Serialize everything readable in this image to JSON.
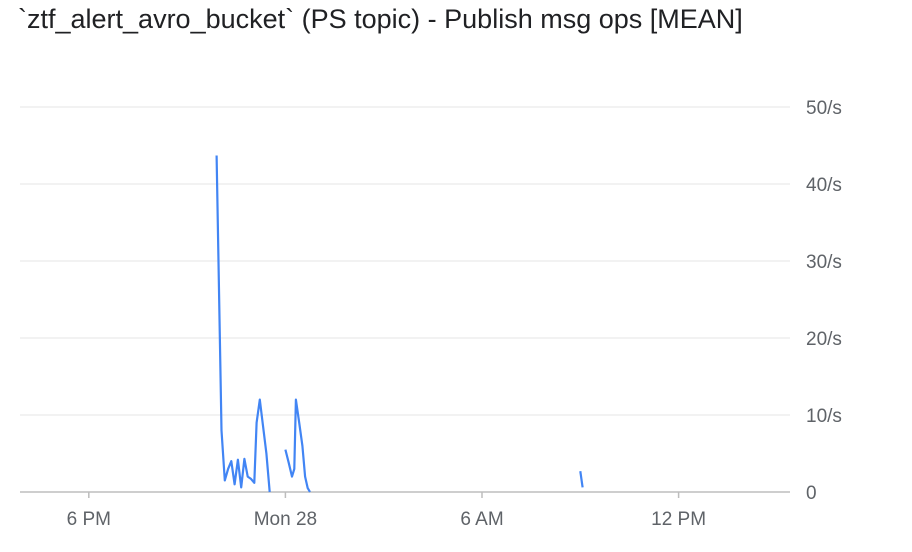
{
  "chart_data": {
    "type": "line",
    "title": "`ztf_alert_avro_bucket` (PS topic) - Publish msg ops [MEAN]",
    "xlabel": "",
    "ylabel": "",
    "y_ticks": [
      "0",
      "10/s",
      "20/s",
      "30/s",
      "40/s",
      "50/s"
    ],
    "ylim": [
      0,
      50
    ],
    "grid": true,
    "x_ticks": [
      {
        "label": "6 PM",
        "hour": 18
      },
      {
        "label": "Mon 28",
        "hour": 24
      },
      {
        "label": "6 AM",
        "hour": 30
      },
      {
        "label": "12 PM",
        "hour": 36
      }
    ],
    "xlim": [
      15.9,
      39.4
    ],
    "series": [
      {
        "color": "#4285f4",
        "segments": [
          [
            [
              21.9,
              43.7
            ],
            [
              22.05,
              8.0
            ],
            [
              22.15,
              1.5
            ],
            [
              22.25,
              3.0
            ],
            [
              22.35,
              4.0
            ],
            [
              22.45,
              1.0
            ],
            [
              22.55,
              4.2
            ],
            [
              22.65,
              0.6
            ],
            [
              22.75,
              4.3
            ],
            [
              22.85,
              2.0
            ],
            [
              22.95,
              1.7
            ],
            [
              23.05,
              1.2
            ],
            [
              23.12,
              9.0
            ],
            [
              23.22,
              12.0
            ],
            [
              23.32,
              8.5
            ],
            [
              23.42,
              5.0
            ],
            [
              23.52,
              0.0
            ]
          ],
          [
            [
              24.0,
              5.5
            ],
            [
              24.1,
              3.8
            ],
            [
              24.2,
              2.0
            ],
            [
              24.27,
              3.0
            ],
            [
              24.32,
              12.0
            ],
            [
              24.42,
              9.0
            ],
            [
              24.52,
              6.0
            ],
            [
              24.6,
              2.0
            ],
            [
              24.68,
              0.5
            ],
            [
              24.75,
              0.0
            ]
          ],
          [
            [
              33.0,
              2.7
            ],
            [
              33.07,
              0.6
            ]
          ]
        ]
      }
    ]
  }
}
